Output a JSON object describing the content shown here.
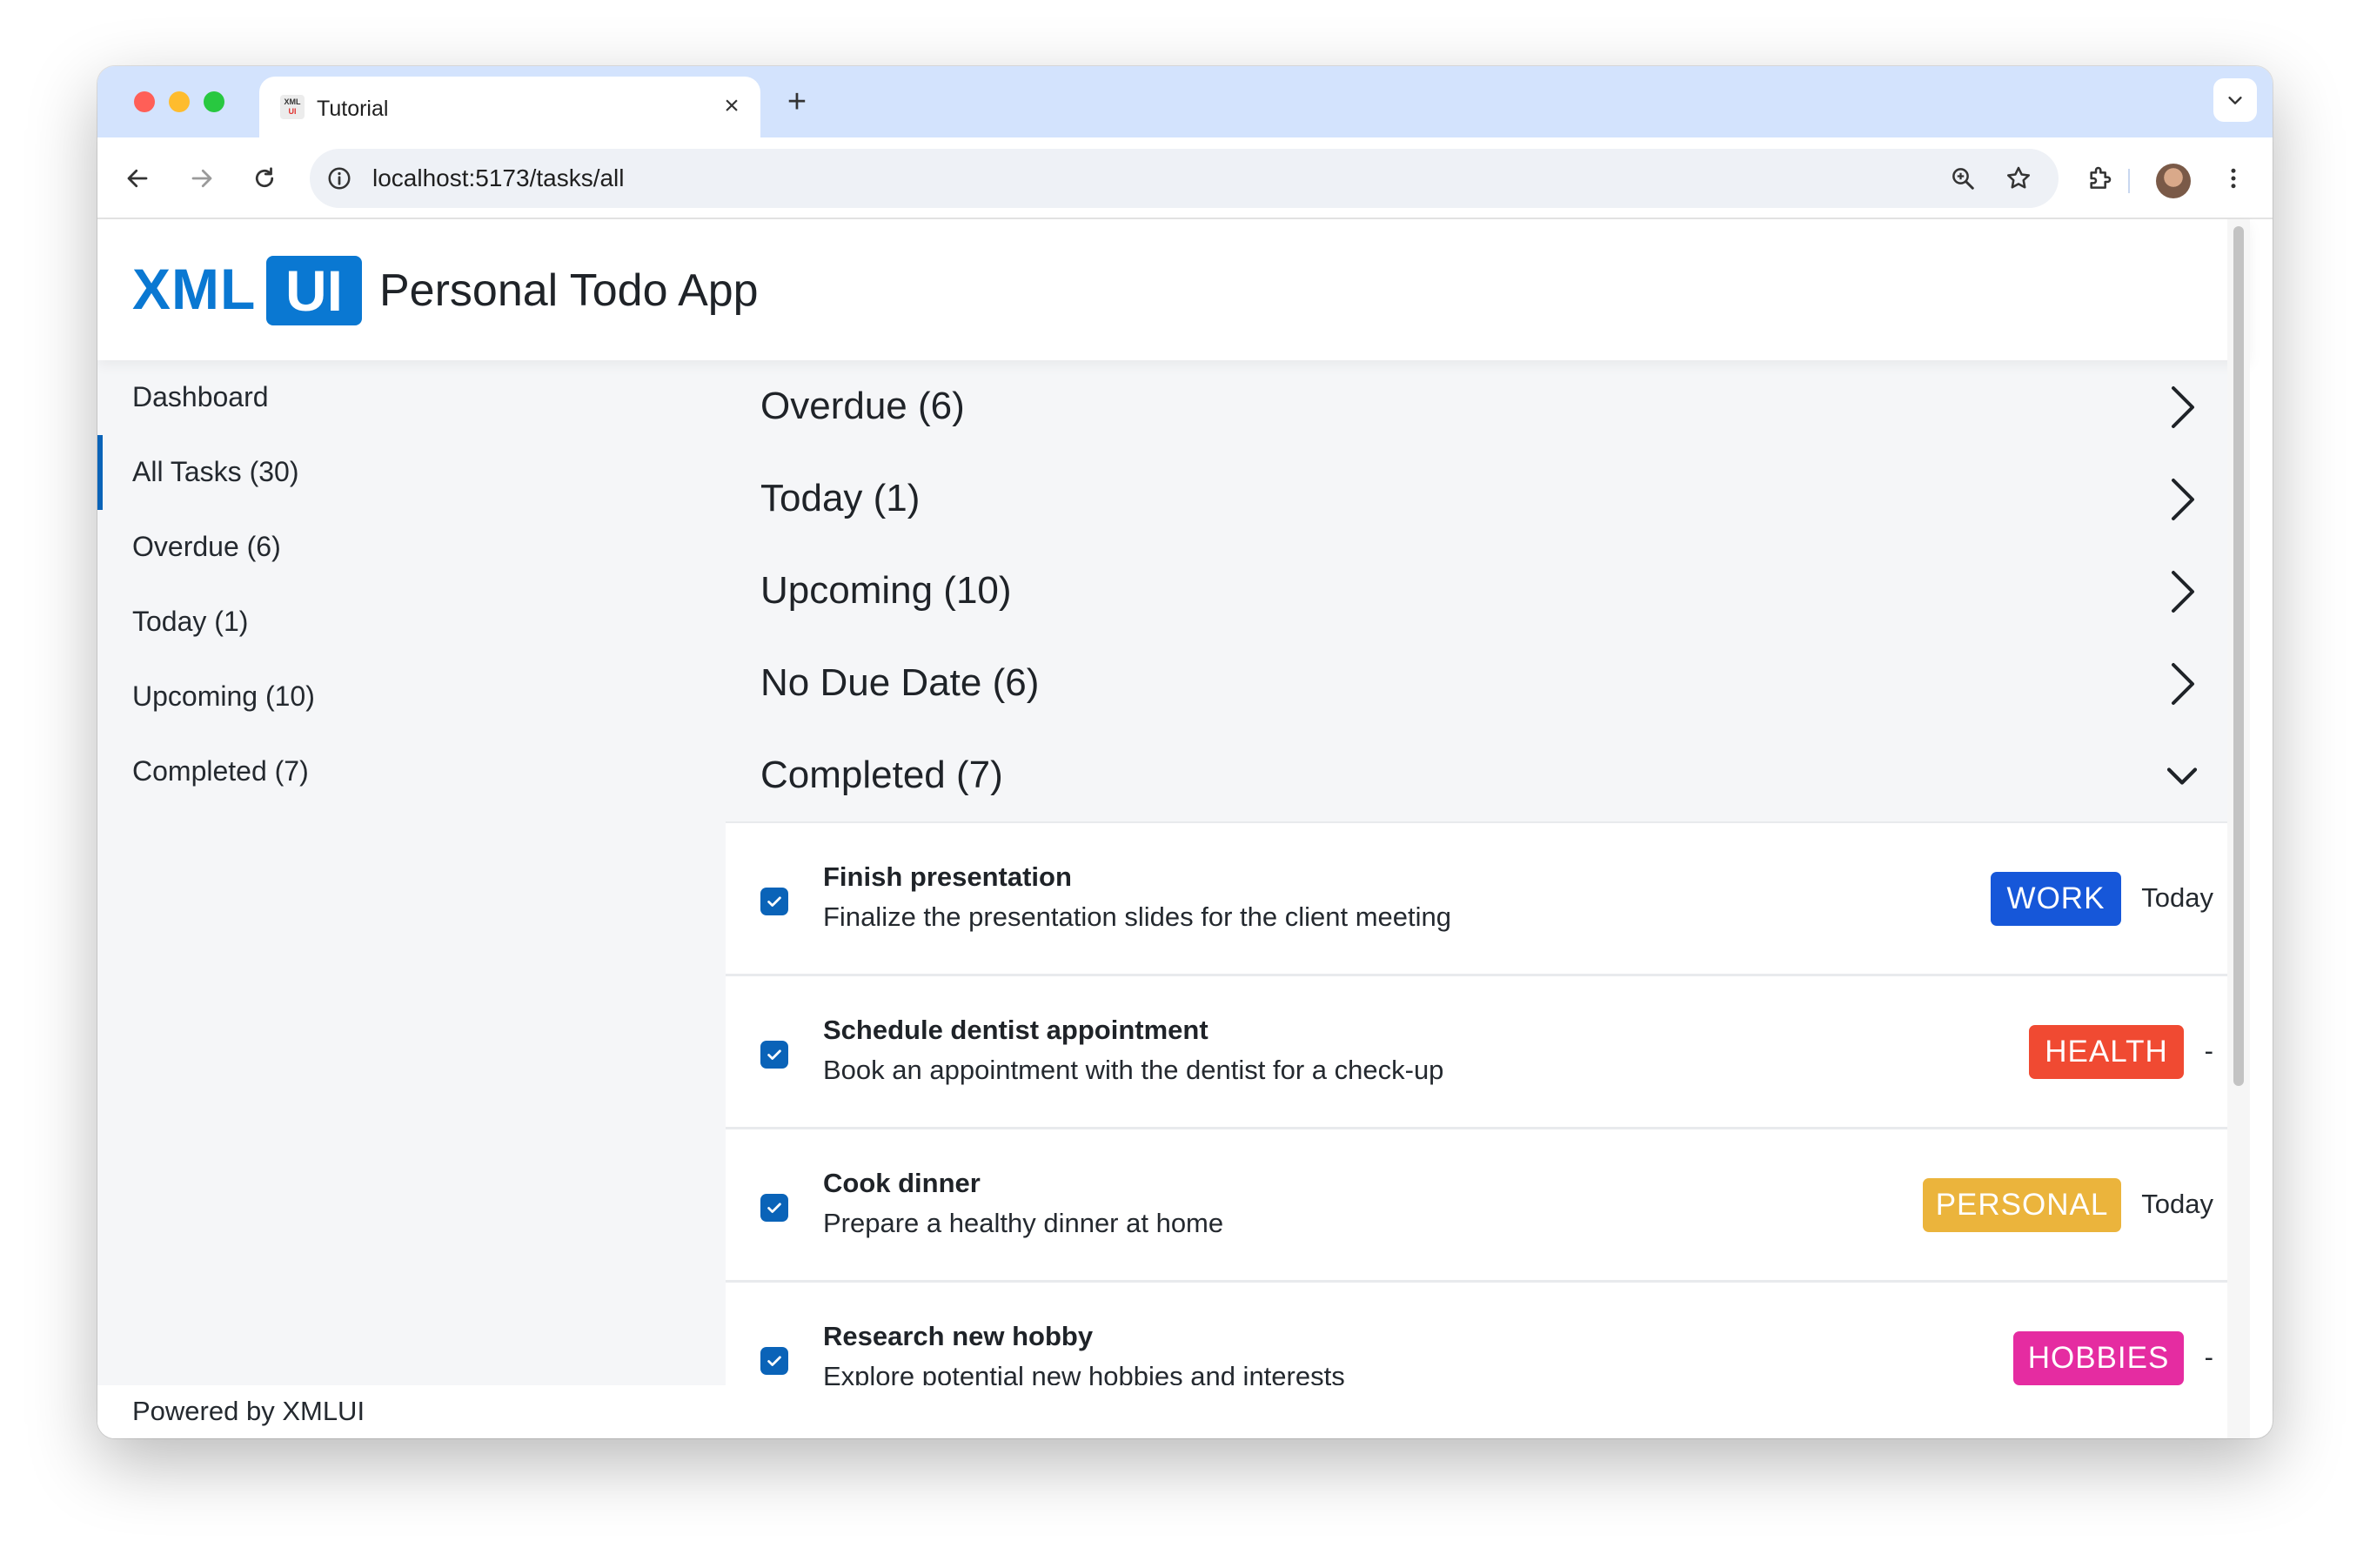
{
  "browser": {
    "tab_title": "Tutorial",
    "favicon_text_top": "XML",
    "favicon_text_bottom": "UI",
    "close_glyph": "×",
    "new_tab_glyph": "+",
    "url": "localhost:5173/tasks/all"
  },
  "header": {
    "logo_text": "XML",
    "logo_badge": "UI",
    "title": "Personal Todo App"
  },
  "sidebar": {
    "items": [
      {
        "label": "Dashboard"
      },
      {
        "label": "All Tasks (30)"
      },
      {
        "label": "Overdue (6)"
      },
      {
        "label": "Today (1)"
      },
      {
        "label": "Upcoming (10)"
      },
      {
        "label": "Completed (7)"
      }
    ]
  },
  "sections": [
    {
      "label": "Overdue (6)",
      "state": "collapsed"
    },
    {
      "label": "Today (1)",
      "state": "collapsed"
    },
    {
      "label": "Upcoming (10)",
      "state": "collapsed"
    },
    {
      "label": "No Due Date (6)",
      "state": "collapsed"
    },
    {
      "label": "Completed (7)",
      "state": "expanded"
    }
  ],
  "tasks": [
    {
      "title": "Finish presentation",
      "description": "Finalize the presentation slides for the client meeting",
      "category": "WORK",
      "category_color": "#1657d9",
      "due": "Today",
      "checked": true
    },
    {
      "title": "Schedule dentist appointment",
      "description": "Book an appointment with the dentist for a check-up",
      "category": "HEALTH",
      "category_color": "#f04a32",
      "due": "-",
      "checked": true
    },
    {
      "title": "Cook dinner",
      "description": "Prepare a healthy dinner at home",
      "category": "PERSONAL",
      "category_color": "#ebb43c",
      "due": "Today",
      "checked": true
    },
    {
      "title": "Research new hobby",
      "description": "Explore potential new hobbies and interests",
      "category": "HOBBIES",
      "category_color": "#e52ca1",
      "due": "-",
      "checked": true
    }
  ],
  "footer": {
    "text": "Powered by XMLUI"
  },
  "colors": {
    "brand": "#0a78d2",
    "accent": "#0a63b8"
  }
}
